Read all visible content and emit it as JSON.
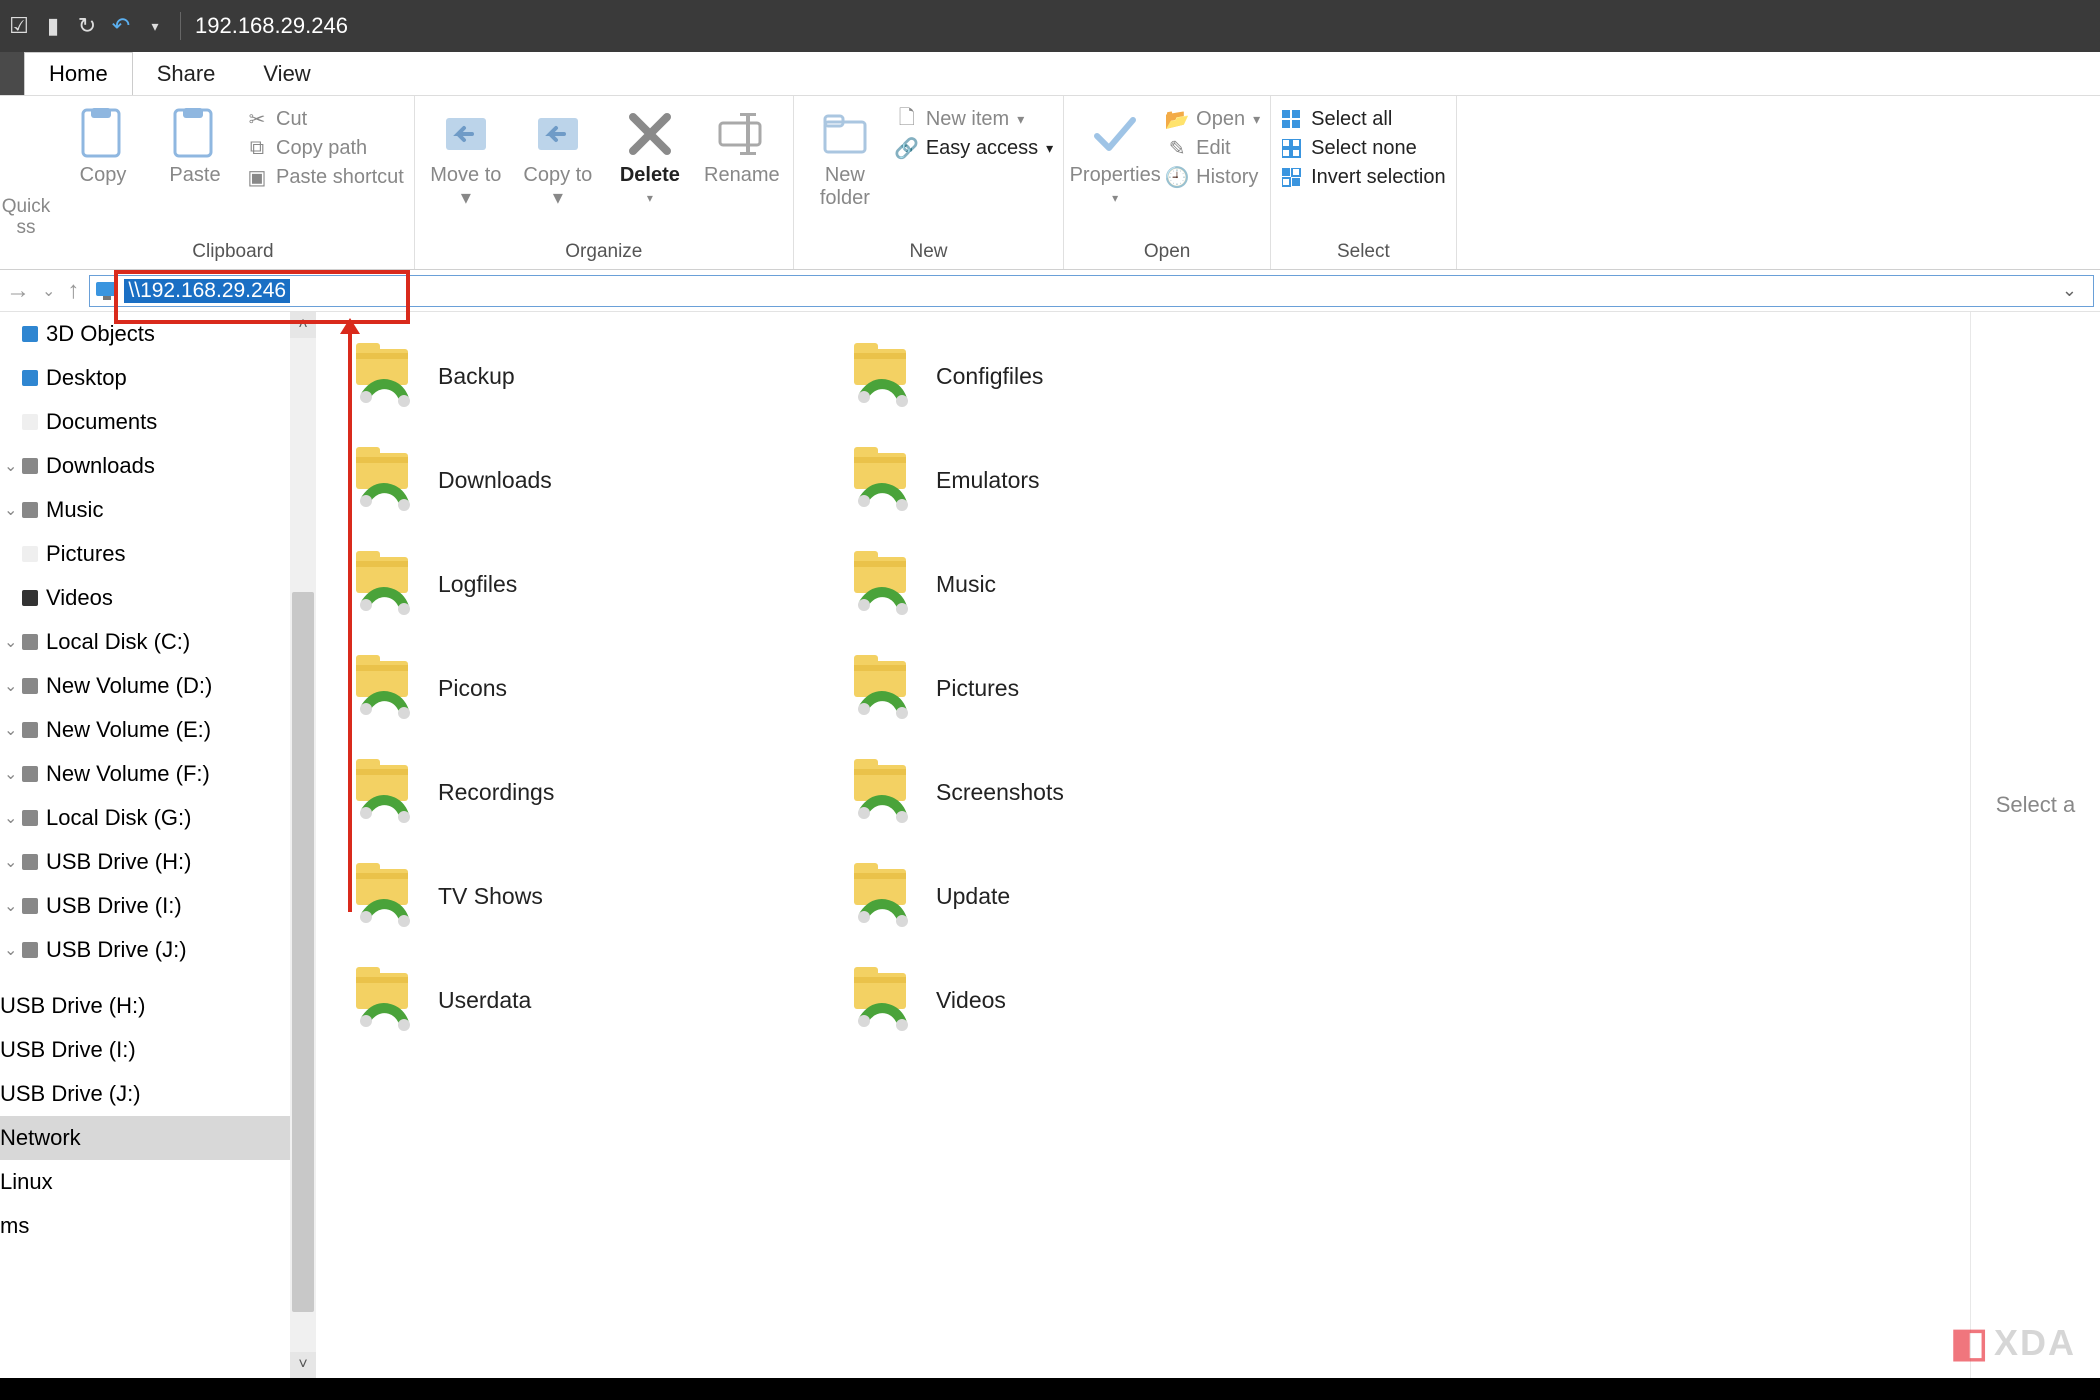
{
  "titlebar": {
    "title": "192.168.29.246"
  },
  "tabs": {
    "home": "Home",
    "share": "Share",
    "view": "View"
  },
  "ribbon": {
    "quick_access": "Quick\nss",
    "clipboard": {
      "label": "Clipboard",
      "copy": "Copy",
      "paste": "Paste",
      "cut": "Cut",
      "copy_path": "Copy path",
      "paste_shortcut": "Paste shortcut"
    },
    "organize": {
      "label": "Organize",
      "move_to": "Move to",
      "copy_to": "Copy to",
      "delete": "Delete",
      "rename": "Rename"
    },
    "new": {
      "label": "New",
      "new_folder": "New folder",
      "new_item": "New item",
      "easy_access": "Easy access"
    },
    "open": {
      "label": "Open",
      "properties": "Properties",
      "open": "Open",
      "edit": "Edit",
      "history": "History"
    },
    "select": {
      "label": "Select",
      "select_all": "Select all",
      "select_none": "Select none",
      "invert": "Invert selection"
    }
  },
  "address_bar": {
    "text": "\\\\192.168.29.246"
  },
  "nav": {
    "items": [
      {
        "label": "3D Objects",
        "icon": "#2f86d1",
        "exp": ""
      },
      {
        "label": "Desktop",
        "icon": "#2f86d1",
        "exp": ""
      },
      {
        "label": "Documents",
        "icon": "#efefef",
        "exp": ""
      },
      {
        "label": "Downloads",
        "icon": "#888",
        "exp": "⌄"
      },
      {
        "label": "Music",
        "icon": "#888",
        "exp": "⌄"
      },
      {
        "label": "Pictures",
        "icon": "#efefef",
        "exp": ""
      },
      {
        "label": "Videos",
        "icon": "#333",
        "exp": ""
      },
      {
        "label": "Local Disk (C:)",
        "icon": "#888",
        "exp": "⌄"
      },
      {
        "label": "New Volume (D:)",
        "icon": "#888",
        "exp": "⌄"
      },
      {
        "label": "New Volume (E:)",
        "icon": "#888",
        "exp": "⌄"
      },
      {
        "label": "New Volume (F:)",
        "icon": "#888",
        "exp": "⌄"
      },
      {
        "label": "Local Disk (G:)",
        "icon": "#888",
        "exp": "⌄"
      },
      {
        "label": "USB Drive (H:)",
        "icon": "#888",
        "exp": "⌄"
      },
      {
        "label": "USB Drive (I:)",
        "icon": "#888",
        "exp": "⌄"
      },
      {
        "label": "USB Drive (J:)",
        "icon": "#888",
        "exp": "⌄"
      }
    ],
    "roots": [
      {
        "label": "USB Drive (H:)"
      },
      {
        "label": "USB Drive (I:)"
      },
      {
        "label": "USB Drive (J:)"
      },
      {
        "label": "Network",
        "selected": true
      },
      {
        "label": "Linux"
      },
      {
        "label": "ms"
      }
    ]
  },
  "folders": [
    "Backup",
    "Configfiles",
    "Downloads",
    "Emulators",
    "Logfiles",
    "Music",
    "Picons",
    "Pictures",
    "Recordings",
    "Screenshots",
    "TV Shows",
    "Update",
    "Userdata",
    "Videos"
  ],
  "preview": {
    "hint": "Select a"
  },
  "watermark": {
    "text": "XDA"
  }
}
